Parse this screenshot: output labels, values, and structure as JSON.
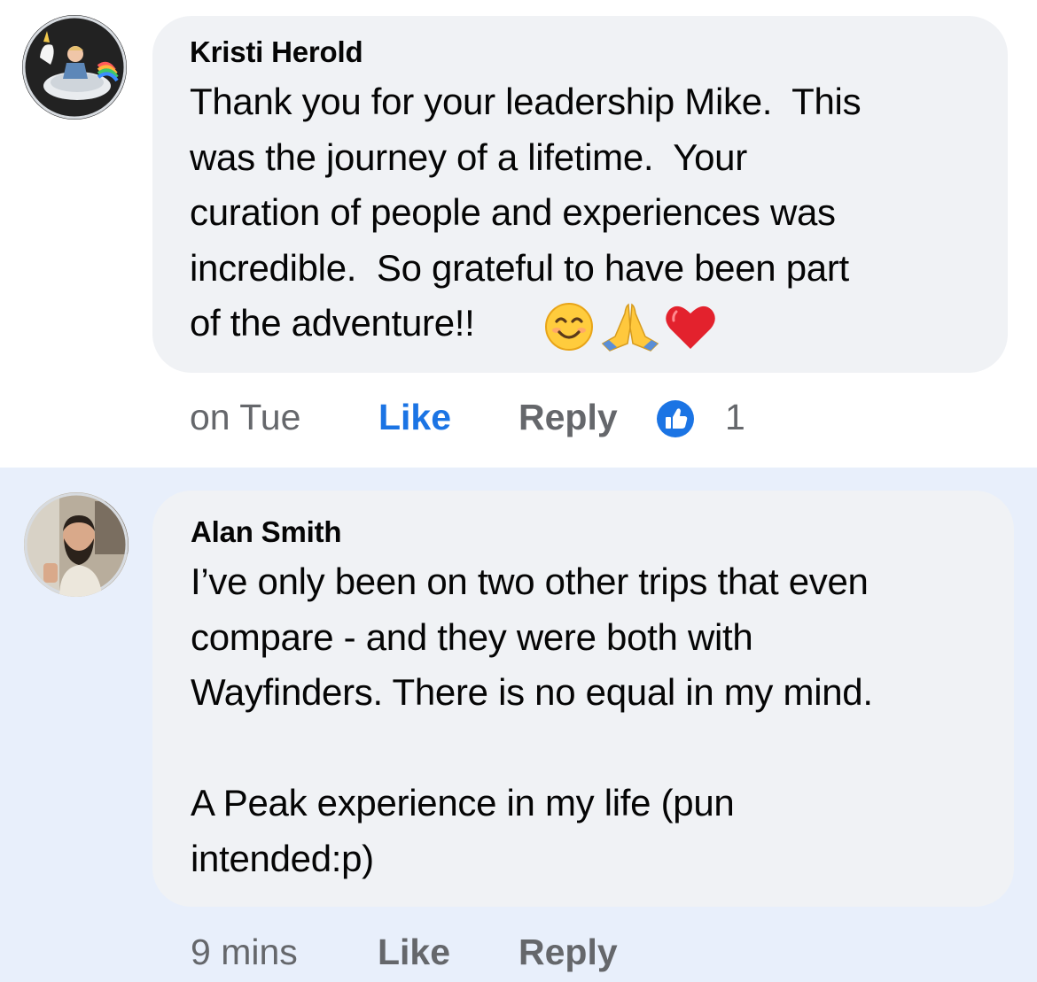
{
  "comments": [
    {
      "author": "Kristi Herold",
      "text_lines": [
        "Thank you for your leadership Mike.  This",
        "was the journey of a lifetime.  Your",
        "curation of people and experiences was",
        "incredible.  So grateful to have been part",
        "of the adventure!!"
      ],
      "emojis": [
        "smiling-face-icon",
        "folded-hands-icon",
        "red-heart-icon"
      ],
      "timestamp": "on Tue",
      "like_label": "Like",
      "like_state": "liked",
      "reply_label": "Reply",
      "reaction_count": "1",
      "reaction_icon": "thumbs-up-reaction-icon",
      "accent_color": "#1b74e4"
    },
    {
      "author": "Alan Smith",
      "text_lines": [
        "I’ve only been on two other trips that even",
        "compare - and they were both with",
        "Wayfinders. There is no equal in my mind.",
        "",
        "A Peak experience in my life (pun",
        "intended:p)"
      ],
      "timestamp": "9 mins",
      "like_label": "Like",
      "like_state": "not-liked",
      "reply_label": "Reply"
    }
  ],
  "colors": {
    "bubble": "#f0f2f5",
    "highlight_row": "#e8effb",
    "meta_text": "#65676b",
    "liked_blue": "#1b74e4"
  }
}
